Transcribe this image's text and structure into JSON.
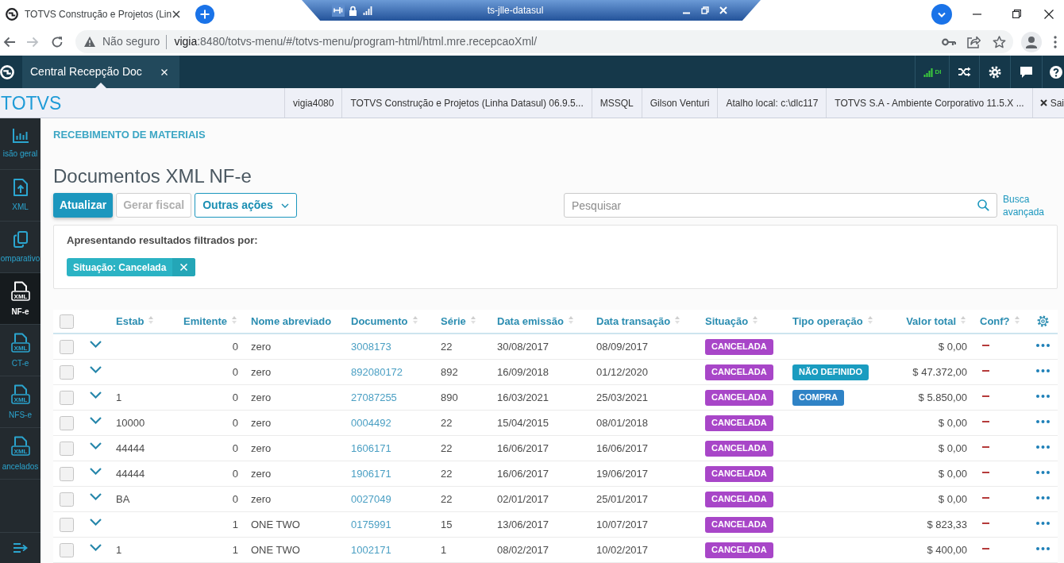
{
  "browser": {
    "tab_title": "TOTVS Construção e Projetos (Lin",
    "security_label": "Não seguro",
    "url_host": "vigia",
    "url_path": ":8480/totvs-menu/#/totvs-menu/program-html/html.mre.recepcaoXml/"
  },
  "remote_bar": {
    "title": "ts-jlle-datasul"
  },
  "app_header": {
    "tab": {
      "label": "Central Recepção Doc"
    },
    "connection_label": "DI"
  },
  "info_bar": {
    "brand": "TOTVS",
    "items": [
      "vigia4080",
      "TOTVS Construção e Projetos (Linha Datasul) 06.9.5...",
      "MSSQL",
      "Gilson Venturi",
      "Atalho local: c:\\dlc117",
      "TOTVS S.A - Ambiente Corporativo 11.5.X ..."
    ],
    "exit_label": "Sai"
  },
  "sidebar": {
    "items": [
      {
        "label": "isão geral",
        "selected": false
      },
      {
        "label": "XML",
        "selected": false
      },
      {
        "label": "omparativo",
        "selected": false
      },
      {
        "label": "NF-e",
        "badge": "XML",
        "selected": true
      },
      {
        "label": "CT-e",
        "badge": "XML",
        "selected": false
      },
      {
        "label": "NFS-e",
        "badge": "XML",
        "selected": false
      },
      {
        "label": "ancelados",
        "badge": "XML",
        "selected": false
      }
    ]
  },
  "page": {
    "breadcrumb": "RECEBIMENTO DE MATERIAIS",
    "title": "Documentos XML NF-e",
    "actions": [
      {
        "label": "Atualizar",
        "kind": "primary",
        "disabled": false
      },
      {
        "label": "Gerar fiscal",
        "kind": "default",
        "disabled": true
      },
      {
        "label": "Outras ações",
        "kind": "dropdown",
        "disabled": false
      }
    ],
    "search": {
      "placeholder": "Pesquisar"
    },
    "advanced_search": "Busca avançada"
  },
  "filter": {
    "title": "Apresentando resultados filtrados por:",
    "tags": [
      {
        "label": "Situação: Cancelada"
      }
    ]
  },
  "table": {
    "header_checkbox": {
      "checked": false
    },
    "columns": [
      {
        "label": "Estab",
        "sortable": true
      },
      {
        "label": "Emitente",
        "sortable": true
      },
      {
        "label": "Nome abreviado",
        "sortable": false
      },
      {
        "label": "Documento",
        "sortable": true
      },
      {
        "label": "Série",
        "sortable": true
      },
      {
        "label": "Data emissão",
        "sortable": true
      },
      {
        "label": "Data transação",
        "sortable": true
      },
      {
        "label": "Situação",
        "sortable": true
      },
      {
        "label": "Tipo operação",
        "sortable": true
      },
      {
        "label": "Valor total",
        "sortable": true
      },
      {
        "label": "Conf?",
        "sortable": true
      }
    ],
    "rows": [
      {
        "checked": false,
        "expanded": false,
        "emitente": "0",
        "nome_abreviado": "zero",
        "documento": "3008173",
        "serie": "22",
        "data_emissao": "30/08/2017",
        "data_transacao": "08/09/2017",
        "situacao": {
          "label": "CANCELADA",
          "color": "#a846c8"
        },
        "valor_total": "$ 0,00",
        "conf": false
      },
      {
        "checked": false,
        "expanded": false,
        "emitente": "0",
        "nome_abreviado": "zero",
        "documento": "892080172",
        "serie": "892",
        "data_emissao": "16/09/2018",
        "data_transacao": "01/12/2020",
        "situacao": {
          "label": "CANCELADA",
          "color": "#a846c8"
        },
        "tipo_operacao": {
          "label": "NÃO DEFINIDO",
          "color": "#1a9cc0"
        },
        "valor_total": "$ 47.372,00",
        "conf": false
      },
      {
        "checked": false,
        "expanded": false,
        "estab": "1",
        "emitente": "0",
        "nome_abreviado": "zero",
        "documento": "27087255",
        "serie": "890",
        "data_emissao": "16/03/2021",
        "data_transacao": "25/03/2021",
        "situacao": {
          "label": "CANCELADA",
          "color": "#a846c8"
        },
        "tipo_operacao": {
          "label": "COMPRA",
          "color": "#2f83c6"
        },
        "valor_total": "$ 5.850,00",
        "conf": false
      },
      {
        "checked": false,
        "expanded": false,
        "estab": "10000",
        "emitente": "0",
        "nome_abreviado": "zero",
        "documento": "0004492",
        "serie": "22",
        "data_emissao": "15/04/2015",
        "data_transacao": "08/01/2018",
        "situacao": {
          "label": "CANCELADA",
          "color": "#a846c8"
        },
        "valor_total": "$ 0,00",
        "conf": false
      },
      {
        "checked": false,
        "expanded": false,
        "estab": "44444",
        "emitente": "0",
        "nome_abreviado": "zero",
        "documento": "1606171",
        "serie": "22",
        "data_emissao": "16/06/2017",
        "data_transacao": "16/06/2017",
        "situacao": {
          "label": "CANCELADA",
          "color": "#a846c8"
        },
        "valor_total": "$ 0,00",
        "conf": false
      },
      {
        "checked": false,
        "expanded": false,
        "estab": "44444",
        "emitente": "0",
        "nome_abreviado": "zero",
        "documento": "1906171",
        "serie": "22",
        "data_emissao": "16/06/2017",
        "data_transacao": "19/06/2017",
        "situacao": {
          "label": "CANCELADA",
          "color": "#a846c8"
        },
        "valor_total": "$ 0,00",
        "conf": false
      },
      {
        "checked": false,
        "expanded": false,
        "estab": "BA",
        "emitente": "0",
        "nome_abreviado": "zero",
        "documento": "0027049",
        "serie": "22",
        "data_emissao": "02/01/2017",
        "data_transacao": "25/01/2017",
        "situacao": {
          "label": "CANCELADA",
          "color": "#a846c8"
        },
        "valor_total": "$ 0,00",
        "conf": false
      },
      {
        "checked": false,
        "expanded": false,
        "emitente": "1",
        "nome_abreviado": "ONE TWO",
        "documento": "0175991",
        "serie": "15",
        "data_emissao": "13/06/2017",
        "data_transacao": "10/07/2017",
        "situacao": {
          "label": "CANCELADA",
          "color": "#a846c8"
        },
        "valor_total": "$ 823,33",
        "conf": false
      },
      {
        "checked": false,
        "expanded": false,
        "estab": "1",
        "emitente": "1",
        "nome_abreviado": "ONE TWO",
        "documento": "1002171",
        "serie": "1",
        "data_emissao": "08/02/2017",
        "data_transacao": "10/02/2017",
        "situacao": {
          "label": "CANCELADA",
          "color": "#a846c8"
        },
        "valor_total": "$ 400,00",
        "conf": false
      }
    ]
  }
}
